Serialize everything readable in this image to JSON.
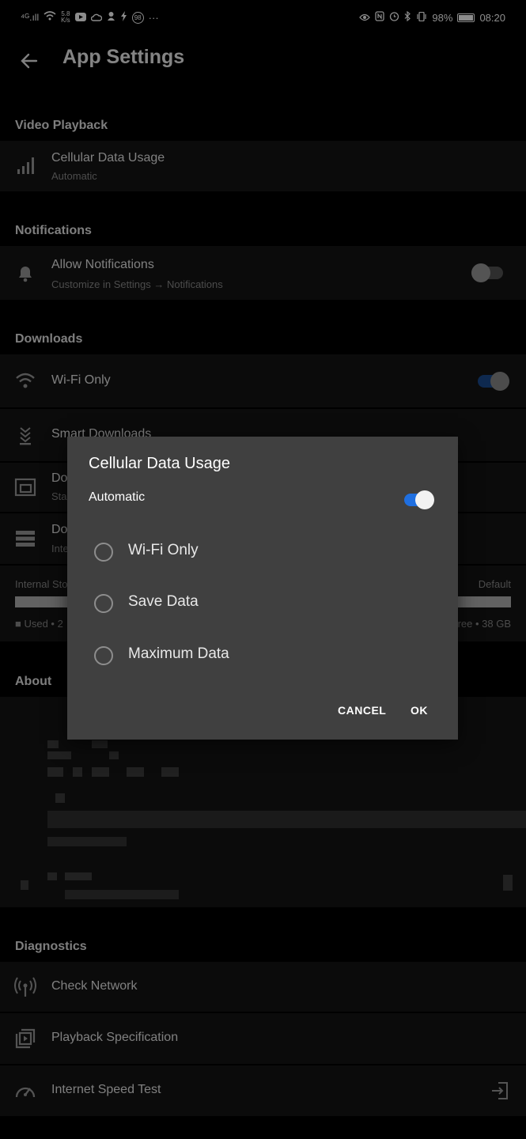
{
  "status_bar": {
    "signal": "⁴ᴳ.ıll",
    "net_speed_value": "5.8",
    "net_speed_unit": "K/s",
    "notification_count": "98",
    "more": "···",
    "battery_percent": "98%",
    "time": "08:20"
  },
  "header": {
    "title": "App Settings",
    "back_icon": "arrow-left-icon"
  },
  "sections": {
    "video_playback": {
      "title": "Video Playback",
      "cellular_label": "Cellular Data Usage",
      "cellular_value": "Automatic"
    },
    "notifications": {
      "title": "Notifications",
      "allow_label": "Allow Notifications",
      "allow_sub": "Customize in Settings → Notifications",
      "allow_enabled": false
    },
    "downloads": {
      "title": "Downloads",
      "wifi_only_label": "Wi-Fi Only",
      "wifi_only_enabled": true,
      "smart_downloads_label": "Smart Downloads",
      "row3_label": "Do",
      "row3_sub": "Sta",
      "row4_label": "Do",
      "row4_sub": "Inte",
      "storage_left": "Internal Sto",
      "storage_right": "Default",
      "legend_used": "■ Used • 2",
      "legend_free": "ree • 38 GB"
    },
    "about": {
      "title": "About"
    },
    "diagnostics": {
      "title": "Diagnostics",
      "check_network": "Check Network",
      "playback_spec": "Playback Specification",
      "speed_test": "Internet Speed Test"
    }
  },
  "dialog": {
    "title": "Cellular Data Usage",
    "automatic_label": "Automatic",
    "automatic_enabled": true,
    "options": [
      "Wi-Fi Only",
      "Save Data",
      "Maximum Data"
    ],
    "cancel": "CANCEL",
    "ok": "OK"
  },
  "colors": {
    "accent": "#1f6fe0",
    "row_bg": "#141414",
    "dialog_bg": "#404040"
  }
}
